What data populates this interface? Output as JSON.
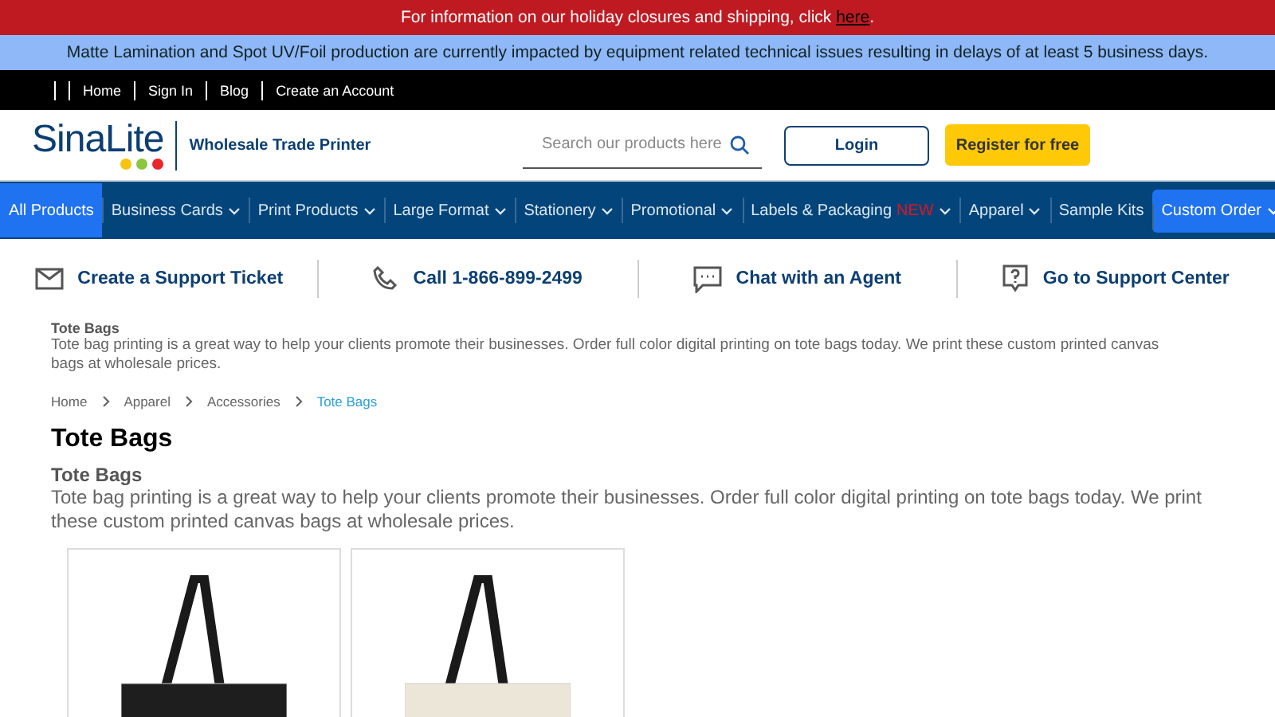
{
  "holiday_banner": {
    "text": "For information on our holiday closures and shipping, click ",
    "link": "here",
    "tail": "."
  },
  "notice_banner": {
    "text": "Matte Lamination and Spot UV/Foil production are currently impacted by equipment related technical issues resulting in delays of at least 5 business days."
  },
  "top_links": [
    "Home",
    "Sign In",
    "Blog",
    "Create an Account"
  ],
  "header": {
    "logo": "SinaLite",
    "tagline": "Wholesale Trade Printer",
    "search": {
      "placeholder": "Search our products here"
    },
    "login": "Login",
    "register": "Register for free"
  },
  "nav": [
    {
      "label": "All Products",
      "kind": "tab",
      "selected": true,
      "has_menu": false
    },
    {
      "label": "Business Cards",
      "kind": "tab",
      "selected": false,
      "has_menu": true
    },
    {
      "label": "Print Products",
      "kind": "tab",
      "selected": false,
      "has_menu": true
    },
    {
      "label": "Large Format",
      "kind": "tab",
      "selected": false,
      "has_menu": true
    },
    {
      "label": "Stationery",
      "kind": "tab",
      "selected": false,
      "has_menu": true
    },
    {
      "label": "Promotional",
      "kind": "tab",
      "selected": false,
      "has_menu": true
    },
    {
      "label": "Labels & Packaging",
      "badge": "NEW",
      "kind": "tab",
      "selected": false,
      "has_menu": true
    },
    {
      "label": "Apparel",
      "kind": "tab",
      "selected": false,
      "has_menu": true
    },
    {
      "label": "Sample Kits",
      "kind": "tab",
      "selected": false,
      "has_menu": false
    },
    {
      "label": "Custom Order",
      "kind": "pill",
      "selected": false,
      "has_menu": true
    }
  ],
  "support": [
    {
      "kind": "mail",
      "label": "Create a Support Ticket"
    },
    {
      "kind": "phone",
      "label": "Call 1-866-899-2499"
    },
    {
      "kind": "chat",
      "label": "Chat with an Agent"
    },
    {
      "kind": "help",
      "label": "Go to Support Center"
    }
  ],
  "intro": {
    "title": "Tote Bags",
    "text": "Tote bag printing is a great way to help your clients promote their businesses. Order full color digital printing on tote bags today. We print these custom printed canvas bags at wholesale prices."
  },
  "breadcrumb": [
    {
      "label": "Home",
      "selected": false
    },
    {
      "label": "Apparel",
      "selected": false
    },
    {
      "label": "Accessories",
      "selected": false
    },
    {
      "label": "Tote Bags",
      "selected": true
    }
  ],
  "page_title": "Tote Bags",
  "category": {
    "title": "Tote Bags",
    "text": "Tote bag printing is a great way to help your clients promote their businesses. Order full color digital printing on tote bags today. We print these custom printed canvas bags at wholesale prices."
  },
  "products": [
    {
      "color": "#1e1e1e"
    },
    {
      "color": "#ece6d8"
    }
  ]
}
